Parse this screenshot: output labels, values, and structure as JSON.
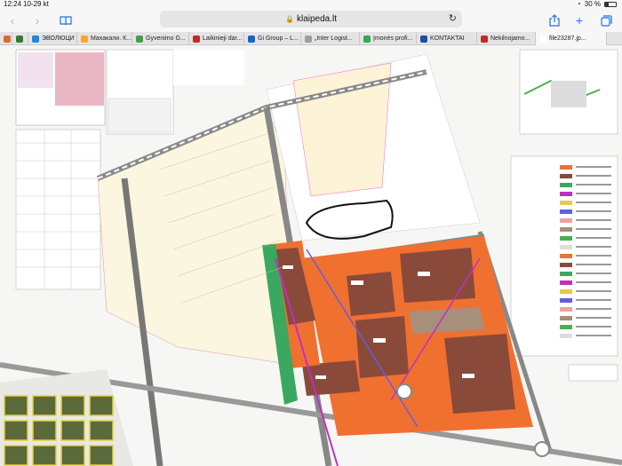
{
  "status": {
    "time": "12:24",
    "date": "10-29 kt",
    "battery": "30 %",
    "battery_level": 0.3
  },
  "toolbar": {
    "back_icon": "chevron-left-icon",
    "forward_icon": "chevron-right-icon",
    "bookmarks_icon": "book-icon",
    "url": "klaipeda.lt",
    "share_icon": "share-icon",
    "new_tab_icon": "plus-icon",
    "tabs_icon": "tabs-icon"
  },
  "tabs": [
    {
      "label": "",
      "color": "#d86b2d"
    },
    {
      "label": "",
      "color": "#2e7d32"
    },
    {
      "label": "ЭВОЛЮЦИ",
      "color": "#1e88e5"
    },
    {
      "label": "Махакали. К...",
      "color": "#f9a825"
    },
    {
      "label": "Gyvenimo G...",
      "color": "#43a047"
    },
    {
      "label": "Laikinieji dar...",
      "color": "#c62828"
    },
    {
      "label": "Gi Group – L...",
      "color": "#1565c0"
    },
    {
      "label": "„Inter Logist...",
      "color": "#9e9e9e"
    },
    {
      "label": "Įmonės profi...",
      "color": "#34a853"
    },
    {
      "label": "KONTAKTAI",
      "color": "#1e4fa3"
    },
    {
      "label": "Nekilnojamo...",
      "color": "#c62828"
    },
    {
      "label": "file23287.jp...",
      "color": "#ffffff"
    }
  ],
  "map": {
    "description_icon": "zoning-plan-image"
  }
}
